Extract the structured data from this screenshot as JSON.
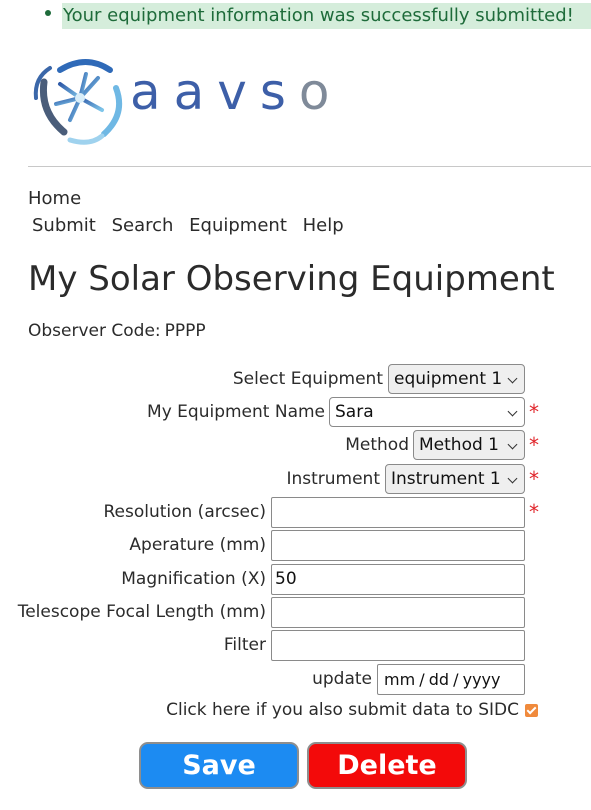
{
  "flash": {
    "message": "Your equipment information was successfully submitted!"
  },
  "logo": {
    "text_main": "aavs",
    "text_last": "o"
  },
  "nav": {
    "home": "Home",
    "items": [
      "Submit",
      "Search",
      "Equipment",
      "Help"
    ]
  },
  "page_title": "My Solar Observing Equipment",
  "observer": {
    "label": "Observer Code:",
    "value": "PPPP"
  },
  "form": {
    "select_equipment": {
      "label": "Select Equipment",
      "value": "equipment 1"
    },
    "equipment_name": {
      "label": "My Equipment Name",
      "value": "Sara"
    },
    "method": {
      "label": "Method",
      "value": "Method 1"
    },
    "instrument": {
      "label": "Instrument",
      "value": "Instrument 1"
    },
    "resolution": {
      "label": "Resolution (arcsec)",
      "value": ""
    },
    "aperture": {
      "label": "Aperature (mm)",
      "value": ""
    },
    "magnification": {
      "label": "Magnification (X)",
      "value": "50"
    },
    "focal_length": {
      "label": "Telescope Focal Length (mm)",
      "value": ""
    },
    "filter": {
      "label": "Filter",
      "value": ""
    },
    "update": {
      "label": "update",
      "placeholder": "mm / dd / yyyy"
    },
    "required_marker": "*",
    "sidc": {
      "label": "Click here if you also submit data to SIDC",
      "checked": true
    }
  },
  "buttons": {
    "save": "Save",
    "delete": "Delete"
  },
  "colors": {
    "flash_bg": "#d5eddb",
    "flash_text": "#1e6b3a",
    "required": "#e0252b",
    "save_bg": "#1c8bf2",
    "delete_bg": "#f30a0a",
    "checkbox": "#f08a3c",
    "logo_blue": "#3d5fa8"
  },
  "icons": {
    "bullet": "dot-icon",
    "dropdown": "chevron-down-icon",
    "checkbox": "checkmark-icon",
    "logo": "aavso-star-logo"
  }
}
